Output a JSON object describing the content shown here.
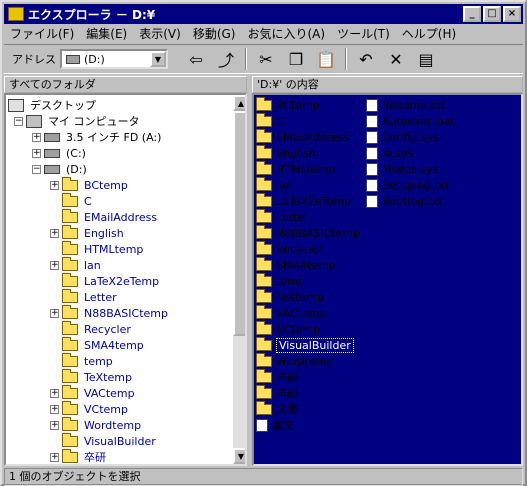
{
  "window": {
    "title": "エクスプローラ － D:¥"
  },
  "menu": [
    "ファイル(F)",
    "編集(E)",
    "表示(V)",
    "移動(G)",
    "お気に入り(A)",
    "ツール(T)",
    "ヘルプ(H)"
  ],
  "toolbar": {
    "address_label": "アドレス",
    "address_value": "(D:)"
  },
  "left_pane": {
    "header": "すべてのフォルダ",
    "tree": [
      {
        "label": "デスクトップ",
        "icon": "desktop"
      },
      {
        "label": "マイ コンピュータ",
        "icon": "computer"
      },
      {
        "label": "3.5 インチ FD (A:)",
        "icon": "drive"
      },
      {
        "label": "(C:)",
        "icon": "drive"
      },
      {
        "label": "(D:)",
        "icon": "drive"
      },
      {
        "label": "BCtemp"
      },
      {
        "label": "C"
      },
      {
        "label": "EMailAddress"
      },
      {
        "label": "English"
      },
      {
        "label": "HTMLtemp"
      },
      {
        "label": "lan"
      },
      {
        "label": "LaTeX2eTemp"
      },
      {
        "label": "Letter"
      },
      {
        "label": "N88BASICtemp"
      },
      {
        "label": "Recycler"
      },
      {
        "label": "SMA4temp"
      },
      {
        "label": "temp"
      },
      {
        "label": "TeXtemp"
      },
      {
        "label": "VACtemp"
      },
      {
        "label": "VCtemp"
      },
      {
        "label": "Wordtemp"
      },
      {
        "label": "VisualBuilder"
      },
      {
        "label": "卒研"
      }
    ]
  },
  "right_pane": {
    "header": "'D:¥' の内容",
    "items": [
      {
        "label": "BCtemp"
      },
      {
        "label": "C"
      },
      {
        "label": "EMailAddress"
      },
      {
        "label": "English"
      },
      {
        "label": "HTMLtemp"
      },
      {
        "label": "lan"
      },
      {
        "label": "LaTeX2eTemp"
      },
      {
        "label": "Letter"
      },
      {
        "label": "N88BASICtemp"
      },
      {
        "label": "Recycler"
      },
      {
        "label": "SMA4temp"
      },
      {
        "label": "temp"
      },
      {
        "label": "TeXtemp"
      },
      {
        "label": "VACtemp"
      },
      {
        "label": "VCtemp"
      },
      {
        "label": "Wordtemp"
      },
      {
        "label": "VisualBuilder"
      },
      {
        "label": "卒研"
      },
      {
        "label": "卒研"
      },
      {
        "label": "文書"
      },
      {
        "label": "論文"
      },
      {
        "label": "Readme.txt"
      },
      {
        "label": "Autoexec.bat"
      },
      {
        "label": "Config.sys"
      },
      {
        "label": "Io.sys"
      },
      {
        "label": "Msdos.sys"
      },
      {
        "label": "Setuplog.txt"
      },
      {
        "label": "Bootlog.txt"
      }
    ],
    "selected": "VisualBuilder"
  },
  "status": {
    "text": "1 個のオブジェクトを選択"
  }
}
